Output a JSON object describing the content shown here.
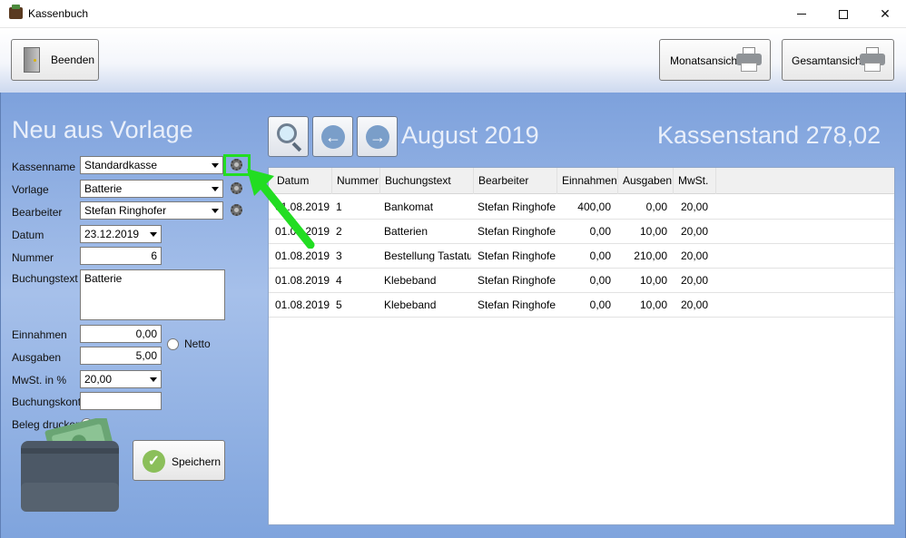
{
  "window": {
    "title": "Kassenbuch"
  },
  "toolbar": {
    "beenden_label": "Beenden",
    "monatsansicht_label": "Monatsansicht",
    "gesamtansicht_label": "Gesamtansicht"
  },
  "header": {
    "form_title": "Neu aus Vorlage",
    "month": "August 2019",
    "kassenstand": "Kassenstand 278,02"
  },
  "form": {
    "kassenname_label": "Kassenname",
    "kassenname_value": "Standardkasse",
    "vorlage_label": "Vorlage",
    "vorlage_value": "Batterie",
    "bearbeiter_label": "Bearbeiter",
    "bearbeiter_value": "Stefan Ringhofer",
    "datum_label": "Datum",
    "datum_value": "23.12.2019",
    "nummer_label": "Nummer",
    "nummer_value": "6",
    "buchungstext_label": "Buchungstext",
    "buchungstext_value": "Batterie",
    "einnahmen_label": "Einnahmen",
    "einnahmen_value": "0,00",
    "ausgaben_label": "Ausgaben",
    "ausgaben_value": "5,00",
    "netto_label": "Netto",
    "mwst_label": "MwSt. in %",
    "mwst_value": "20,00",
    "buchungskonto_label": "Buchungskonto",
    "buchungskonto_value": "",
    "beleg_label": "Beleg drucken",
    "save_label": "Speichern"
  },
  "table": {
    "columns": [
      "Datum",
      "Nummer",
      "Buchungstext",
      "Bearbeiter",
      "Einnahmen",
      "Ausgaben",
      "MwSt."
    ],
    "rows": [
      [
        "01.08.2019",
        "1",
        "Bankomat",
        "Stefan Ringhofer",
        "400,00",
        "0,00",
        "20,00"
      ],
      [
        "01.08.2019",
        "2",
        "Batterien",
        "Stefan Ringhofer",
        "0,00",
        "10,00",
        "20,00"
      ],
      [
        "01.08.2019",
        "3",
        "Bestellung Tastatur",
        "Stefan Ringhofer",
        "0,00",
        "210,00",
        "20,00"
      ],
      [
        "01.08.2019",
        "4",
        "Klebeband",
        "Stefan Ringhofer",
        "0,00",
        "10,00",
        "20,00"
      ],
      [
        "01.08.2019",
        "5",
        "Klebeband",
        "Stefan Ringhofer",
        "0,00",
        "10,00",
        "20,00"
      ]
    ]
  },
  "colors": {
    "highlight": "#22dd22",
    "accent_title": "#e9effa"
  }
}
